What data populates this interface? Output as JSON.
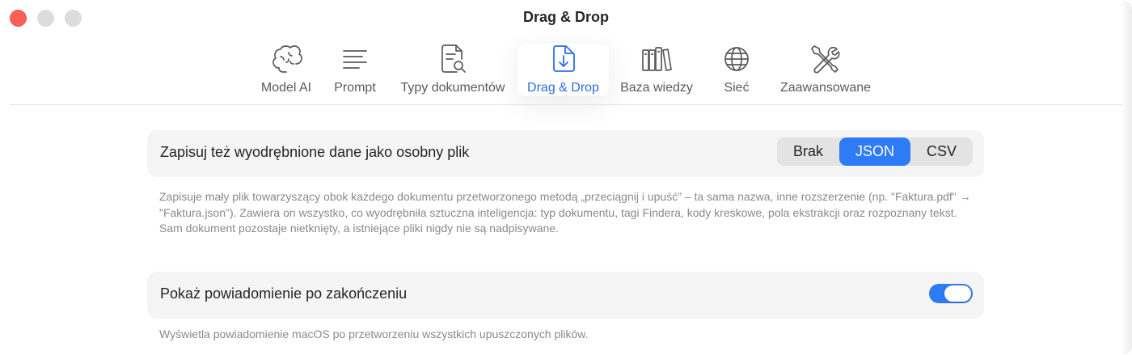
{
  "window": {
    "title": "Drag & Drop"
  },
  "toolbar": {
    "items": [
      {
        "label": "Model AI",
        "icon": "brain-icon",
        "active": false
      },
      {
        "label": "Prompt",
        "icon": "text-lines-icon",
        "active": false
      },
      {
        "label": "Typy dokumentów",
        "icon": "document-search-icon",
        "active": false
      },
      {
        "label": "Drag & Drop",
        "icon": "document-download-icon",
        "active": true
      },
      {
        "label": "Baza wiedzy",
        "icon": "books-icon",
        "active": false
      },
      {
        "label": "Sieć",
        "icon": "globe-icon",
        "active": false
      },
      {
        "label": "Zaawansowane",
        "icon": "tools-icon",
        "active": false
      }
    ]
  },
  "settings": {
    "export_row": {
      "label": "Zapisuj też wyodrębnione dane jako osobny plik",
      "options": [
        "Brak",
        "JSON",
        "CSV"
      ],
      "selected": "JSON",
      "description": "Zapisuje mały plik towarzyszący obok każdego dokumentu przetworzonego metodą „przeciągnij i upuść” – ta sama nazwa, inne rozszerzenie (np. \"Faktura.pdf\" → \"Faktura.json\"). Zawiera on wszystko, co wyodrębniła sztuczna inteligencja: typ dokumentu, tagi Findera, kody kreskowe, pola ekstrakcji oraz rozpoznany tekst. Sam dokument pozostaje nietknięty, a istniejące pliki nigdy nie są nadpisywane."
    },
    "notify_row": {
      "label": "Pokaż powiadomienie po zakończeniu",
      "enabled": true,
      "description": "Wyświetla powiadomienie macOS po przetworzeniu wszystkich upuszczonych plików."
    }
  },
  "colors": {
    "accent": "#2d7cf6",
    "active_tab_text": "#2b6ee8",
    "close_light": "#fe5f57",
    "row_background": "#f5f5f5"
  }
}
